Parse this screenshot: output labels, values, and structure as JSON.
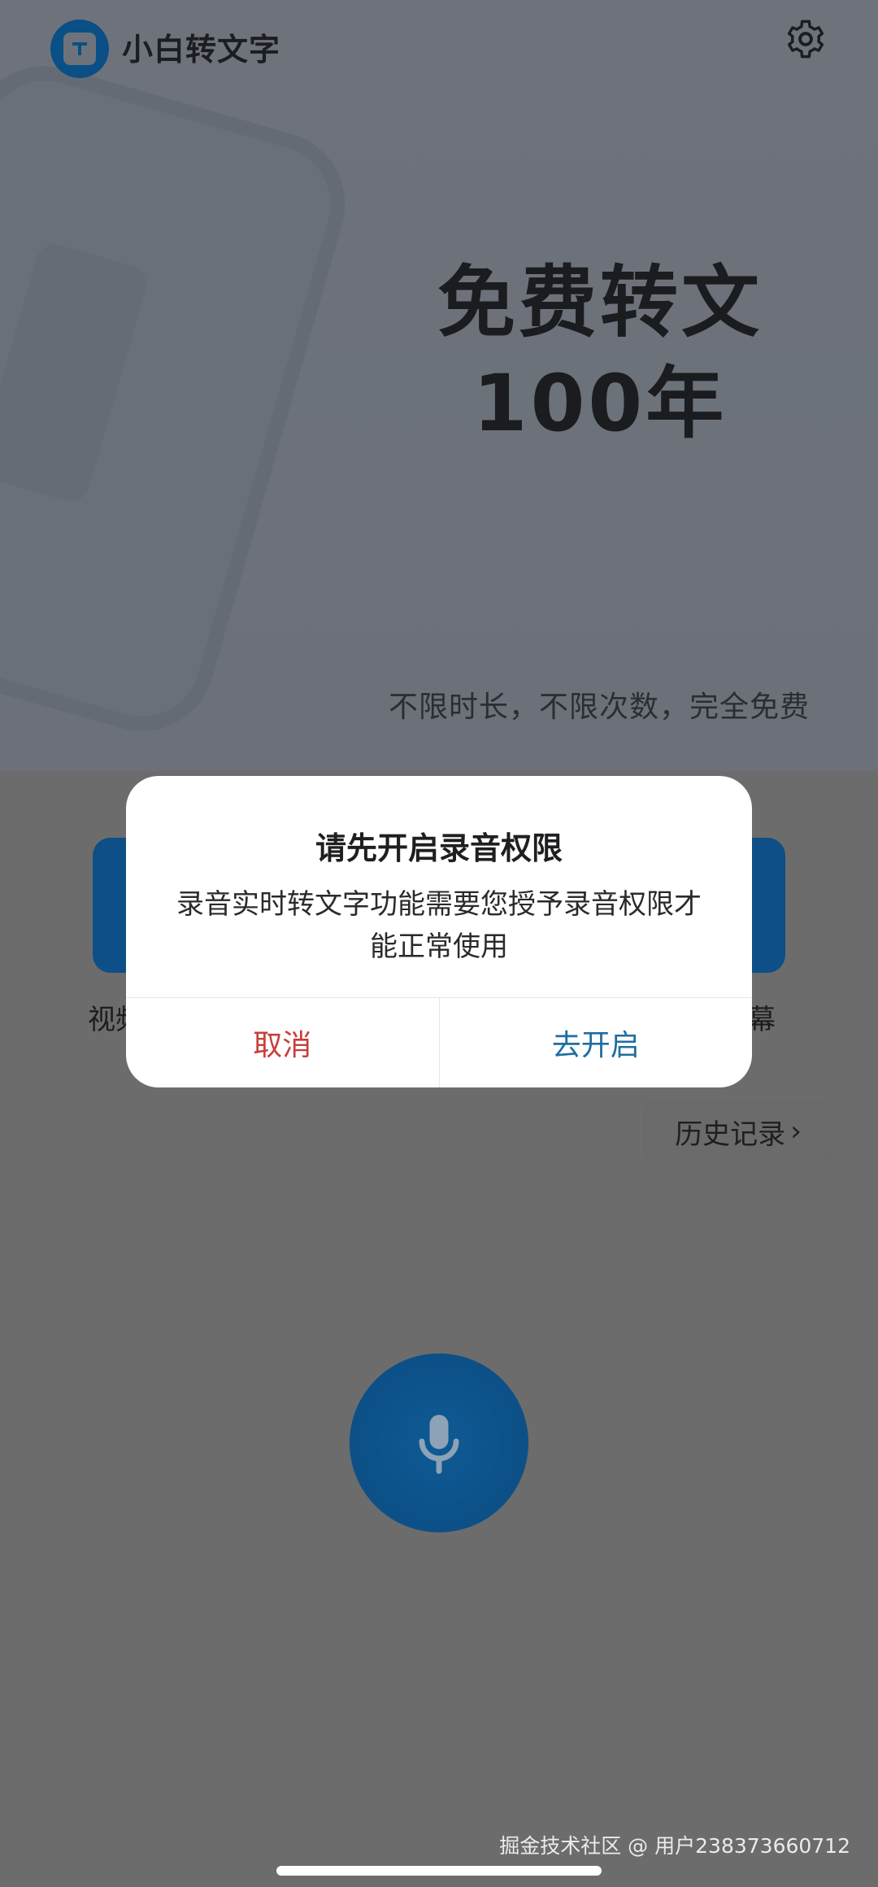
{
  "app": {
    "title": "小白转文字"
  },
  "hero": {
    "headline_line1": "免费转文",
    "headline_line2": "100年",
    "subtitle": "不限时长，不限次数，完全免费"
  },
  "features": {
    "left_label_partial": "视频",
    "right_label_partial": "幕"
  },
  "history": {
    "label": "历史记录",
    "chevron": "›"
  },
  "dialog": {
    "title": "请先开启录音权限",
    "message": "录音实时转文字功能需要您授予录音权限才能正常使用",
    "cancel_label": "取消",
    "confirm_label": "去开启"
  },
  "watermark": {
    "text": "掘金技术社区 @ 用户238373660712"
  },
  "colors": {
    "brand_blue": "#0a4f86",
    "dialog_cancel": "#c73e3a",
    "dialog_confirm": "#1f6ea0"
  },
  "icons": {
    "settings": "gear-icon",
    "mic": "microphone-icon",
    "logo": "app-logo-icon",
    "history_chevron": "chevron-right-icon"
  }
}
